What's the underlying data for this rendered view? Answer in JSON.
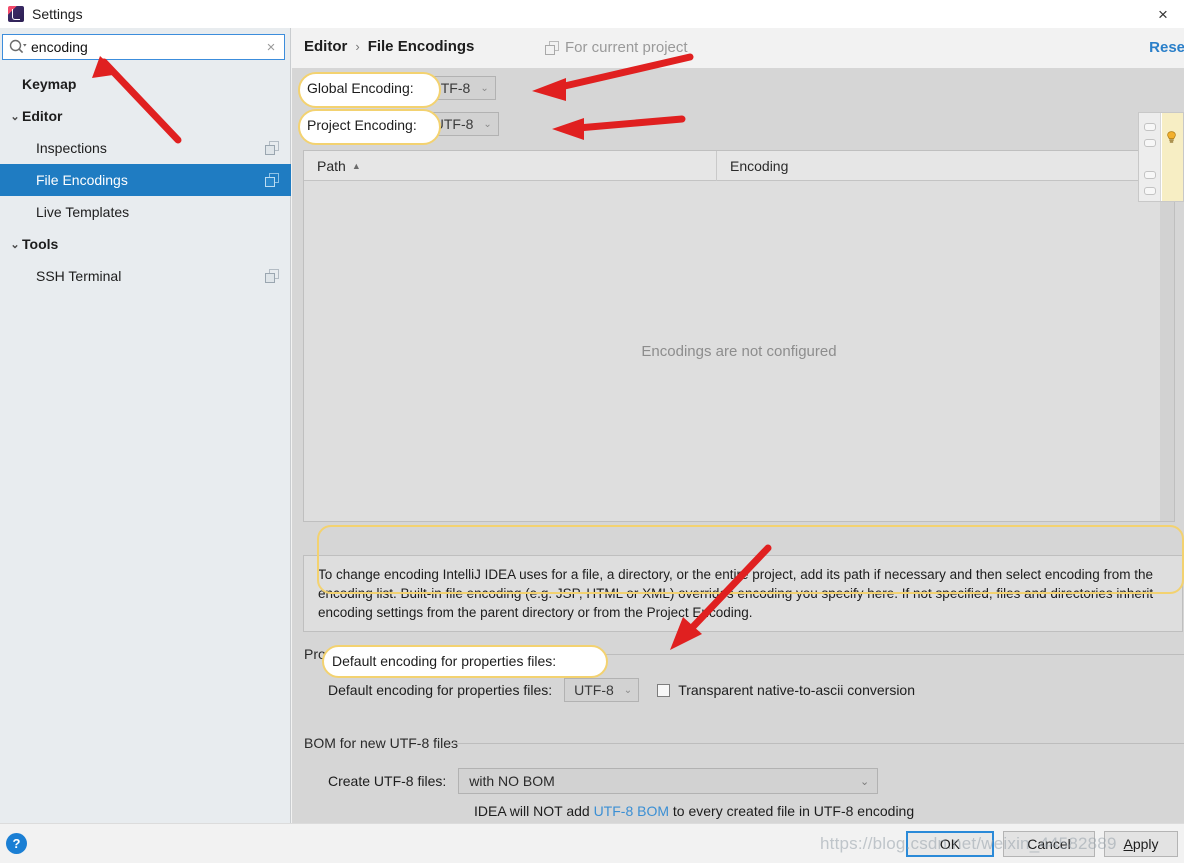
{
  "window": {
    "title": "Settings",
    "app_icon": "intellij-idea-icon",
    "close_label": "×"
  },
  "sidebar": {
    "search": {
      "value": "encoding",
      "placeholder": "Search settings",
      "icon": "search-icon",
      "clear_icon": "×"
    },
    "items": [
      {
        "label": "Keymap",
        "level": 0,
        "bold": true,
        "chevron": "",
        "selected": false,
        "copy_icon": false
      },
      {
        "label": "Editor",
        "level": 0,
        "bold": true,
        "chevron": "⌄",
        "selected": false,
        "copy_icon": false
      },
      {
        "label": "Inspections",
        "level": 1,
        "bold": false,
        "chevron": "",
        "selected": false,
        "copy_icon": true
      },
      {
        "label": "File Encodings",
        "level": 1,
        "bold": false,
        "chevron": "",
        "selected": true,
        "copy_icon": true
      },
      {
        "label": "Live Templates",
        "level": 1,
        "bold": false,
        "chevron": "",
        "selected": false,
        "copy_icon": false
      },
      {
        "label": "Tools",
        "level": 0,
        "bold": true,
        "chevron": "⌄",
        "selected": false,
        "copy_icon": false
      },
      {
        "label": "SSH Terminal",
        "level": 1,
        "bold": false,
        "chevron": "",
        "selected": false,
        "copy_icon": true
      }
    ]
  },
  "header": {
    "breadcrumb_parent": "Editor",
    "breadcrumb_sep": "›",
    "breadcrumb_current": "File Encodings",
    "for_current_project": "For current project",
    "for_current_project_icon": "copy-pages-icon",
    "reset_label": "Reset"
  },
  "encodings": {
    "global_label": "Global Encoding:",
    "global_value": "UTF-8",
    "project_label": "Project Encoding:",
    "project_value": "UTF-8",
    "chevron": "⌄"
  },
  "table": {
    "columns": [
      "Path",
      "Encoding"
    ],
    "sort_column": "Path",
    "sort_arrow": "▲",
    "rows": [],
    "empty_text": "Encodings are not configured"
  },
  "tip": {
    "text": "To change encoding IntelliJ IDEA uses for a file, a directory, or the entire project, add its path if necessary and then select encoding from the encoding list. Built-in file encoding (e.g. JSP, HTML or XML) overrides encoding you specify here. If not specified, files and directories inherit encoding settings from the parent directory or from the Project Encoding."
  },
  "properties_section": {
    "title": "Properties Files (*.properties)",
    "default_encoding_label": "Default encoding for properties files:",
    "default_encoding_value": "UTF-8",
    "chevron": "⌄",
    "transparent_checkbox_label": "Transparent native-to-ascii conversion",
    "transparent_checked": false
  },
  "bom_section": {
    "title": "BOM for new UTF-8 files",
    "create_label": "Create UTF-8 files:",
    "create_value": "with NO BOM",
    "chevron": "⌄",
    "hint_prefix": "IDEA will NOT add ",
    "hint_link": "UTF-8 BOM",
    "hint_suffix": " to every created file in UTF-8 encoding"
  },
  "footer": {
    "help_label": "?",
    "ok_label": "OK",
    "cancel_label": "Cancel",
    "apply_label": "Apply",
    "apply_mnemonic": "A",
    "apply_rest": "pply"
  },
  "popup": {
    "icon": "lightbulb-icon"
  },
  "watermark": {
    "text": "https://blog.csdn.net/weixin_44582889"
  },
  "colors": {
    "selection_blue": "#1f7cc2",
    "link_blue": "#2a7fc9",
    "annotation_yellow": "#f3d270",
    "annotation_red": "#e02020",
    "panel_gray": "#d6d6d6",
    "sidebar_gray": "#e8ecef"
  }
}
